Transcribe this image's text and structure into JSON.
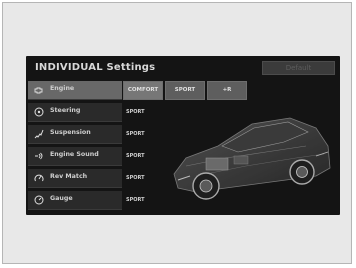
{
  "screen": {
    "title": "INDIVIDUAL Settings",
    "default_label": "Default"
  },
  "settings": [
    {
      "label": "Engine",
      "icon": "engine-icon",
      "value": ""
    },
    {
      "label": "Steering",
      "icon": "steering-wheel-icon",
      "value": "SPORT"
    },
    {
      "label": "Suspension",
      "icon": "suspension-icon",
      "value": "SPORT"
    },
    {
      "label": "Engine Sound",
      "icon": "engine-sound-icon",
      "value": "SPORT"
    },
    {
      "label": "Rev Match",
      "icon": "rev-match-icon",
      "value": "SPORT"
    },
    {
      "label": "Gauge",
      "icon": "gauge-icon",
      "value": "SPORT"
    }
  ],
  "engine_options": [
    "COMFORT",
    "SPORT",
    "+R"
  ],
  "colors": {
    "screen_bg": "#141414",
    "selected_row": "#686868"
  }
}
